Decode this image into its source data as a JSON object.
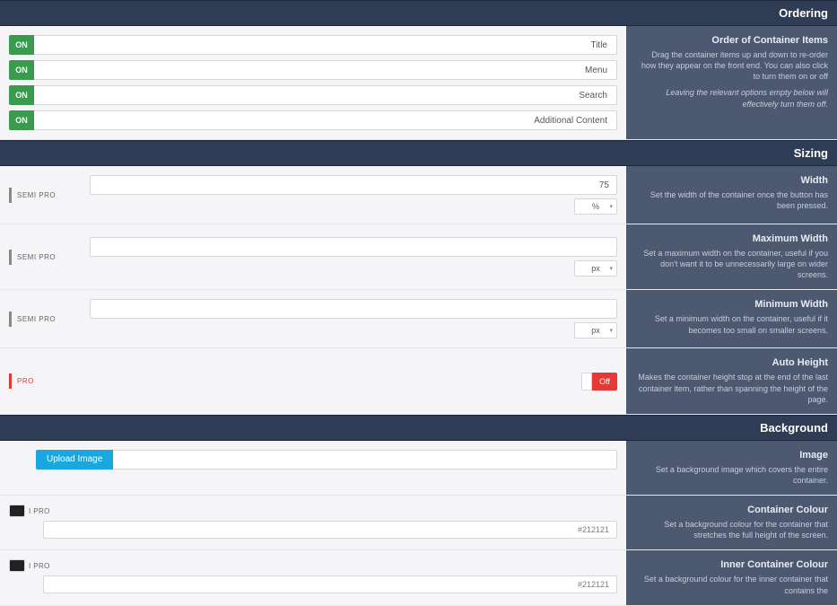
{
  "sections": {
    "ordering": {
      "header": "Ordering",
      "help_title": "Order of Container Items",
      "help_desc": "Drag the container items up and down to re-order how they appear on the front end. You can also click to turn them on or off",
      "help_note": "Leaving the relevant options empty below will effectively turn them off.",
      "on_label": "ON",
      "items": [
        {
          "label": "Title"
        },
        {
          "label": "Menu"
        },
        {
          "label": "Search"
        },
        {
          "label": "Additional Content"
        }
      ]
    },
    "sizing": {
      "header": "Sizing",
      "tier_semi": "SEMI PRO",
      "tier_pro": "PRO",
      "rows": {
        "width": {
          "title": "Width",
          "desc": "Set the width of the container once the button has been pressed.",
          "value": "75",
          "unit": "%"
        },
        "max_width": {
          "title": "Maximum Width",
          "desc": "Set a maximum width on the container, useful if you don't want it to be unnecessarily large on wider screens.",
          "value": "",
          "unit": "px"
        },
        "min_width": {
          "title": "Minimum Width",
          "desc": "Set a minimum width on the container, useful if it becomes too small on smaller screens.",
          "value": "",
          "unit": "px"
        },
        "auto_height": {
          "title": "Auto Height",
          "desc": "Makes the container height stop at the end of the last container item, rather than spanning the height of the page.",
          "toggle": "Off"
        }
      }
    },
    "background": {
      "header": "Background",
      "tier_semi": "I PRO",
      "rows": {
        "image": {
          "title": "Image",
          "desc": "Set a background image which covers the entire container.",
          "upload_label": "Upload Image"
        },
        "container_colour": {
          "title": "Container Colour",
          "desc": "Set a background colour for the container that stretches the full height of the screen.",
          "value": "#212121",
          "swatch": "#212121"
        },
        "inner_colour": {
          "title": "Inner Container Colour",
          "desc": "Set a background colour for the inner container that contains the",
          "value": "#212121",
          "swatch": "#212121"
        }
      }
    }
  }
}
